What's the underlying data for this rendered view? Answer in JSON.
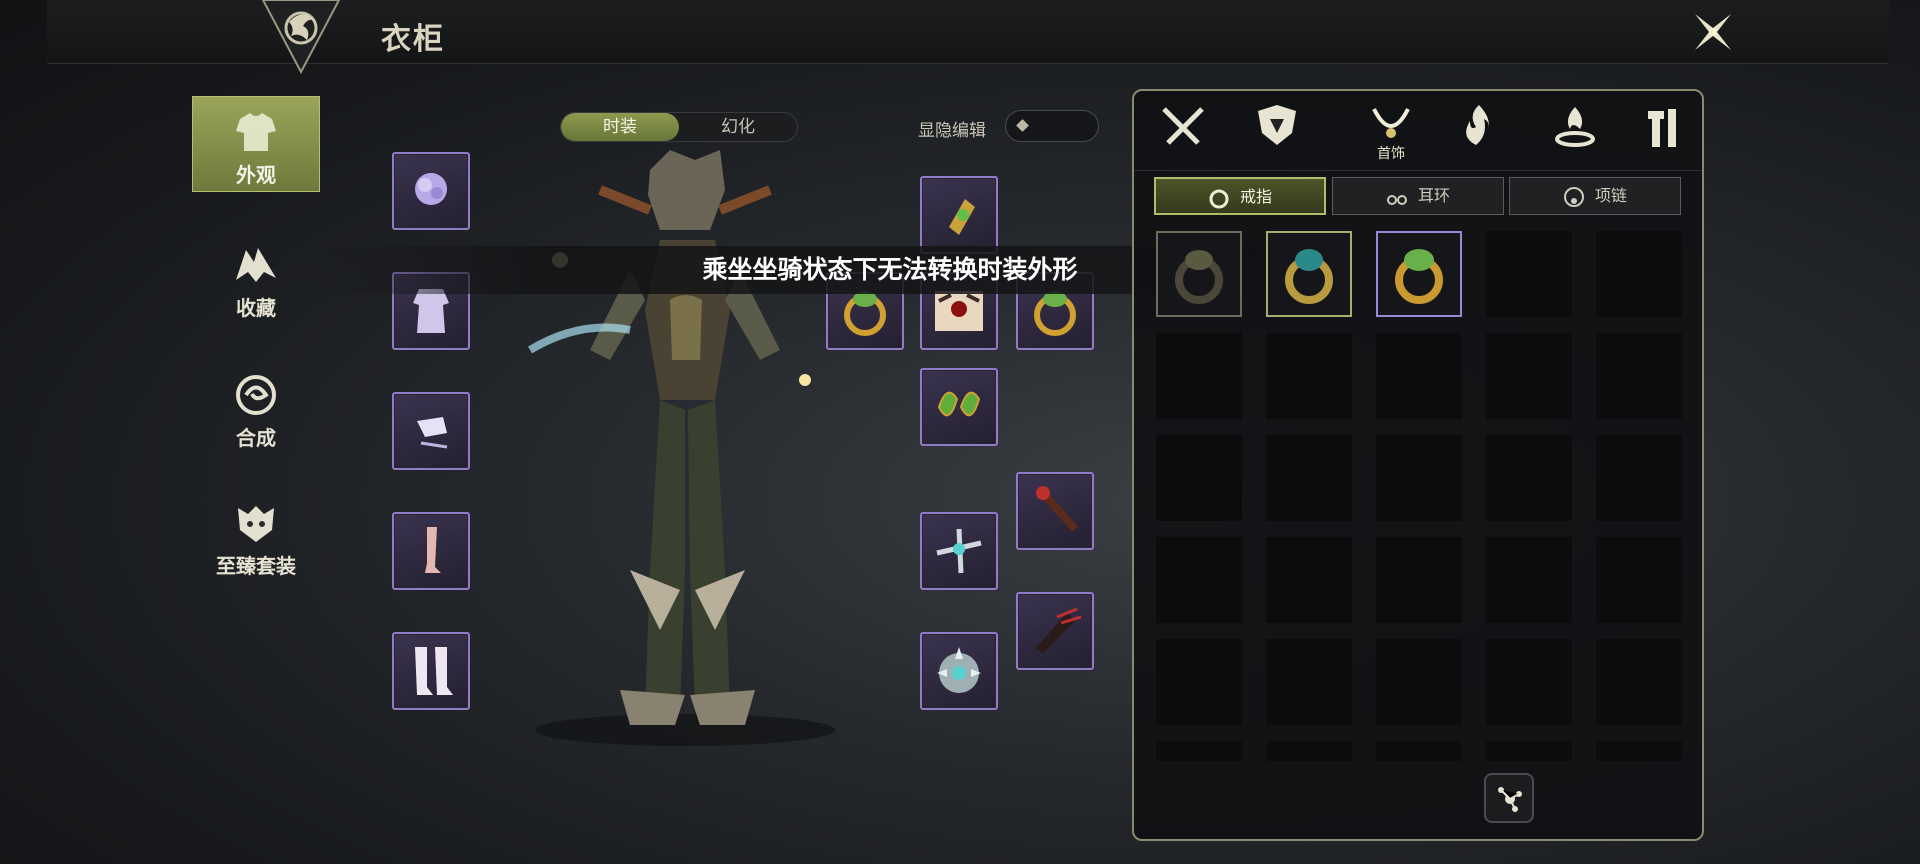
{
  "header": {
    "title": "衣柜"
  },
  "nav": [
    {
      "label": "外观",
      "icon": "armor-icon",
      "active": true
    },
    {
      "label": "收藏",
      "icon": "dragon-wing-icon",
      "active": false
    },
    {
      "label": "合成",
      "icon": "swirl-icon",
      "active": false
    },
    {
      "label": "至臻套装",
      "icon": "beast-head-icon",
      "active": false
    }
  ],
  "mode_toggle": {
    "options": [
      "时装",
      "幻化"
    ],
    "selected": "时装"
  },
  "edit_toggle": {
    "label": "显隐编辑"
  },
  "notice": "乘坐坐骑状态下无法转换时装外形",
  "slots_left": [
    "flower-headpiece-icon",
    "robe-icon",
    "glove-icon",
    "leg-icon",
    "boots-icon"
  ],
  "slots_right": [
    "amulet-icon",
    "ring-icon",
    "mask-icon",
    "ring-icon",
    "leaf-earring-icon",
    "scepter-icon",
    "crossbow-icon",
    "dark-weapon-icon",
    "shield-icon"
  ],
  "categories": [
    {
      "icon": "crossed-swords-icon",
      "label": ""
    },
    {
      "icon": "armor-crest-icon",
      "label": ""
    },
    {
      "icon": "necklace-icon",
      "label": "首饰",
      "active": true
    },
    {
      "icon": "flame-icon",
      "label": ""
    },
    {
      "icon": "fire-pit-icon",
      "label": ""
    },
    {
      "icon": "tools-icon",
      "label": ""
    }
  ],
  "subtabs": [
    {
      "label": "戒指",
      "icon": "ring-outline-icon",
      "active": true
    },
    {
      "label": "耳环",
      "icon": "earring-icon",
      "active": false
    },
    {
      "label": "项链",
      "icon": "pendant-icon",
      "active": false
    }
  ],
  "inventory": [
    {
      "item": "ring-dark-icon",
      "state": "normal"
    },
    {
      "item": "ring-teal-gem-icon",
      "state": "selected"
    },
    {
      "item": "ring-green-gem-icon",
      "state": "equipped"
    }
  ],
  "colors": {
    "accent": "#8e9a4e",
    "slot_border": "#8f7cc6",
    "panel_border": "#8c8a6c"
  }
}
